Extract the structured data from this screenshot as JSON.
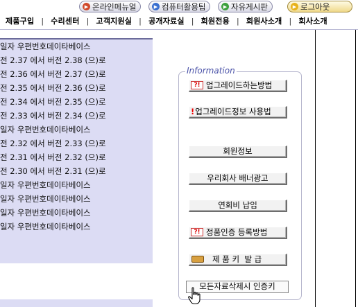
{
  "top_buttons": [
    {
      "label": "온라인메뉴얼"
    },
    {
      "label": "컴퓨터활용팁"
    },
    {
      "label": "자유게시판"
    },
    {
      "label": "로그아웃"
    }
  ],
  "menu": [
    {
      "label": "제품구입"
    },
    {
      "label": "수리센터"
    },
    {
      "label": "고객지원실"
    },
    {
      "label": "공개자료실"
    },
    {
      "label": "회원전용"
    },
    {
      "label": "회원사소개"
    },
    {
      "label": "회사소개"
    }
  ],
  "menu_separator": "|",
  "list_items": [
    "일자 우편번호데이타베이스",
    "전 2.37 에서 버전 2.38 (으)로",
    "전 2.36 에서 버전 2.37 (으)로",
    "전 2.35 에서 버전 2.36 (으)로",
    "전 2.34 에서 버전 2.35 (으)로",
    "전 2.33 에서 버전 2.34 (으)로",
    "일자 우편번호데이타베이스",
    "전 2.32 에서 버전 2.33 (으)로",
    "전 2.31 에서 버전 2.32 (으)로",
    "전 2.30 에서 버전 2.31 (으)로",
    "일자 우편번호데이타베이스",
    "일자 우편번호데이타베이스",
    "일자 우편번호데이타베이스",
    "일자 우편번호데이타베이스"
  ],
  "info": {
    "title": "Information",
    "badge_text": "?!",
    "bang_text": "!",
    "buttons": [
      {
        "label": "업그레이드하는방법"
      },
      {
        "label": "업그레이드정보 사용법"
      },
      {
        "label": "회원정보"
      },
      {
        "label": "우리회사 배너광고"
      },
      {
        "label": "연회비 납입"
      },
      {
        "label": "정품인증 등록방법"
      },
      {
        "label": "제 품 키  발 급"
      },
      {
        "label": "모든자료삭제시 인증키"
      }
    ]
  },
  "colors": {
    "panel_bg": "#dcdcf4",
    "info_title": "#4a52a8"
  },
  "icons": [
    "arrow-right-icon",
    "question-exclamation-icon",
    "exclamation-icon",
    "key-icon",
    "hand-cursor-icon"
  ]
}
